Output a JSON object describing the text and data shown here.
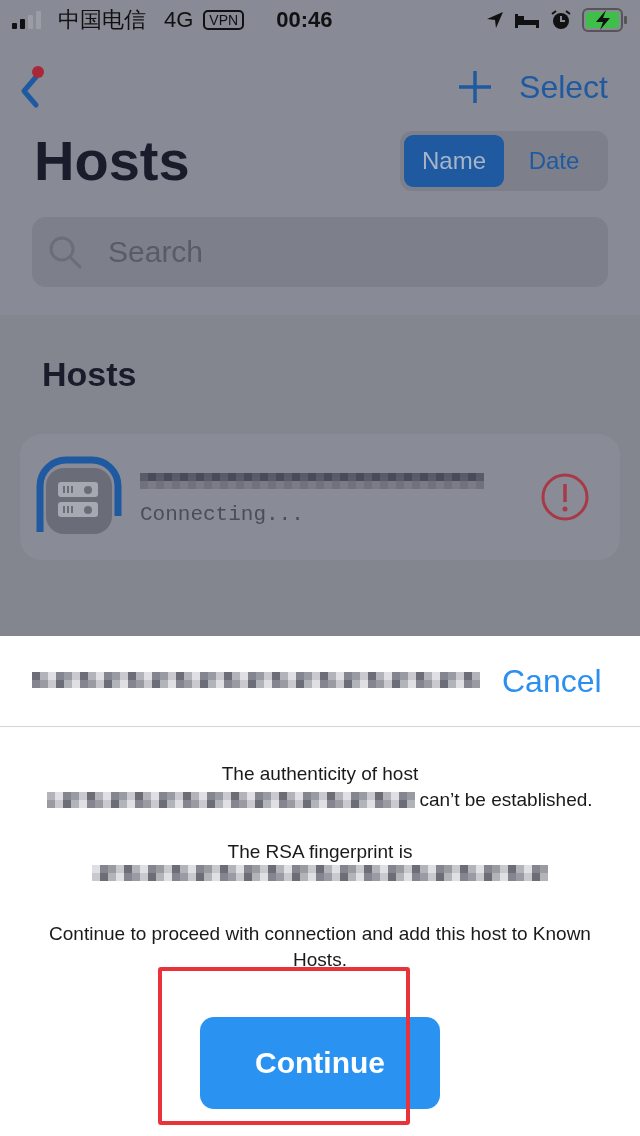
{
  "status_bar": {
    "carrier": "中国电信",
    "network": "4G",
    "vpn": "VPN",
    "time": "00:46"
  },
  "nav": {
    "select": "Select"
  },
  "title": "Hosts",
  "sort": [
    {
      "label": "Name",
      "selected": true
    },
    {
      "label": "Date",
      "selected": false
    }
  ],
  "search": {
    "placeholder": "Search"
  },
  "section": "Hosts",
  "hosts": [
    {
      "status": "Connecting...",
      "warning": true
    }
  ],
  "sheet": {
    "cancel": "Cancel",
    "host_line_1": "The authenticity of host",
    "host_line_2": "can’t be established.",
    "fingerprint_label": "The RSA fingerprint is",
    "message": "Continue to proceed with connection and add this host to Known Hosts.",
    "button": "Continue"
  }
}
